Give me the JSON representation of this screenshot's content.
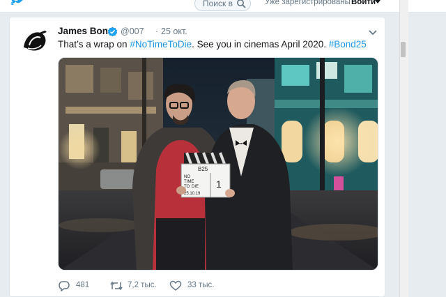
{
  "header": {
    "search_placeholder": "Поиск в",
    "login_question": "Уже зарегистрированы?",
    "login_label": "Войти",
    "brand_color": "#1da1f2"
  },
  "tweet": {
    "author_name": "James Bond",
    "author_handle": "@007",
    "separator": "·",
    "date": "25 окт.",
    "text_prefix": "That’s a wrap on",
    "hashtag_1": "#NoTimeToDie",
    "text_middle": ". See you in cinemas April 2020.",
    "hashtag_2": "#Bond25",
    "link_color": "#1b95e0",
    "photo": {
      "clapperboard_scene": "B25",
      "clapperboard_title_line1": "NO",
      "clapperboard_title_line2": "TIME",
      "clapperboard_title_line3": "TO",
      "clapperboard_title_line4": "DIE",
      "clapperboard_take": "1",
      "clapperboard_date": "25.10.19"
    },
    "actions": {
      "replies": "481",
      "retweets": "7,2 тыс.",
      "likes": "33 тыс."
    }
  },
  "icons": [
    "twitter-bird-icon",
    "search-icon",
    "caret-down-icon",
    "verified-badge-icon",
    "chevron-down-icon",
    "reply-icon",
    "retweet-icon",
    "like-icon"
  ]
}
